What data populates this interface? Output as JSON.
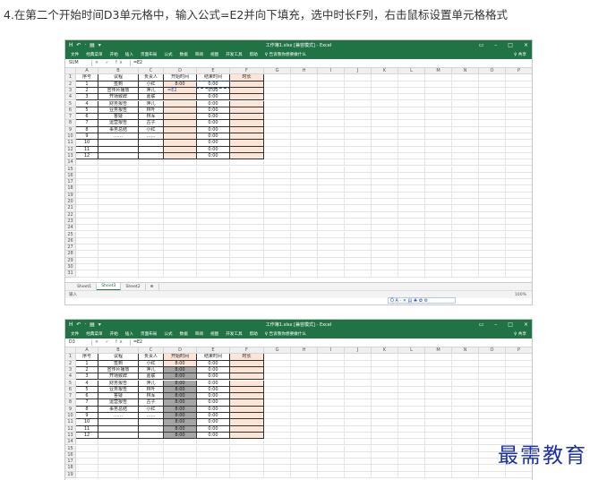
{
  "instruction": "4.在第二个开始时间D3单元格中，输入公式=E2并向下填充，选中时长F列，右击鼠标设置单元格格式",
  "excel": {
    "title": "工作簿1.xlsx [兼容模式] - Excel",
    "quick_access": "H ↶ · ▤ ▾",
    "window_buttons": [
      "▭",
      "–",
      "□",
      "×"
    ],
    "ribbon_tabs": [
      "文件",
      "经典菜单",
      "开始",
      "插入",
      "页面布局",
      "公式",
      "数据",
      "审阅",
      "视图",
      "开发工具",
      "帮助",
      "♀ 告诉我你想要做什么"
    ],
    "share": "♀ 共享",
    "column_headers": [
      "A",
      "B",
      "C",
      "D",
      "E",
      "F",
      "G",
      "H",
      "I",
      "J",
      "K",
      "L",
      "M",
      "N",
      "O",
      "P"
    ],
    "table_headers": [
      "序号",
      "议程",
      "负责人",
      "开始时间",
      "结束时间",
      "时长"
    ],
    "rows": [
      {
        "no": "1",
        "agenda": "签到",
        "owner": "小红"
      },
      {
        "no": "2",
        "agenda": "宣传片播放",
        "owner": "萍儿"
      },
      {
        "no": "3",
        "agenda": "开场致辞",
        "owner": "嘉联"
      },
      {
        "no": "4",
        "agenda": "财务报告",
        "owner": "萍儿"
      },
      {
        "no": "5",
        "agenda": "业务报告",
        "owner": "林叶"
      },
      {
        "no": "6",
        "agenda": "答疑",
        "owner": "林军"
      },
      {
        "no": "7",
        "agenda": "运营报告",
        "owner": "古子"
      },
      {
        "no": "8",
        "agenda": "事务总结",
        "owner": "小红"
      },
      {
        "no": "9",
        "agenda": "……",
        "owner": "……"
      },
      {
        "no": "10",
        "agenda": "",
        "owner": ""
      },
      {
        "no": "11",
        "agenda": "",
        "owner": ""
      },
      {
        "no": "12",
        "agenda": "",
        "owner": ""
      }
    ],
    "time_value": "8:00",
    "end_value": "0:00",
    "sheet_tabs": [
      "Sheet1",
      "Sheet3",
      "Sheet2"
    ],
    "add_sheet": "⊕",
    "zoom": "100%"
  },
  "shot1": {
    "name_box": "SUM",
    "formula_icons": "× ✓ fx",
    "formula": "=E2",
    "cell_edit": "=E2",
    "status": "输入"
  },
  "shot2": {
    "name_box": "D3",
    "formula_icons": "× ✓ fx",
    "formula": "=E2",
    "f_header": "时长"
  },
  "ime": "Ö A · ✕ ▤ ♣ ✿ ⚙",
  "watermark": "最需教育"
}
